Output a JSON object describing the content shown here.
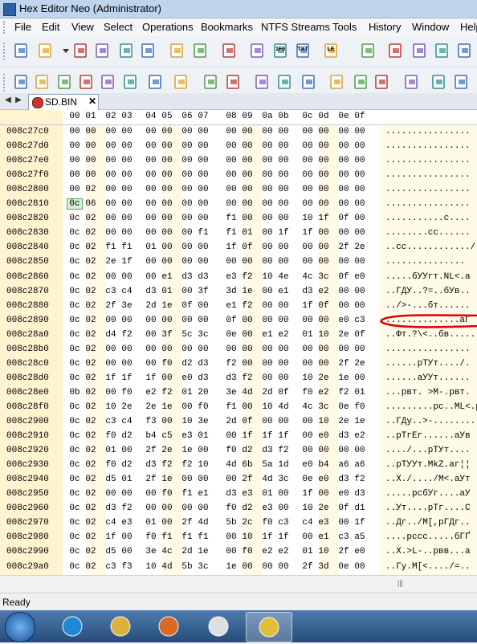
{
  "window": {
    "title": "Hex Editor Neo (Administrator)"
  },
  "menu": [
    "File",
    "Edit",
    "View",
    "Select",
    "Operations",
    "Bookmarks",
    "NTFS Streams",
    "Tools",
    "History",
    "Window",
    "Help"
  ],
  "toolbar1": [
    "new-document-icon",
    "open-folder-icon",
    "dropdown-arrow-icon",
    "save-icon",
    "save-as-icon",
    "save-all-icon",
    "print-icon",
    "close-document-icon",
    "close-all-icon",
    "refresh-icon",
    "data-inspector-icon",
    "view-hex-icon",
    "view-text-icon",
    "little-endian-icon",
    "grid-icon",
    "find-icon",
    "replace-icon",
    "find-next-icon",
    "plugin-icon"
  ],
  "toolbar1_labels": {
    "view_hex": "1F0",
    "view_text": "TXT",
    "endian": "LE"
  },
  "toolbar2": [
    "undo-icon",
    "redo-icon",
    "edit-icon",
    "insert-icon",
    "import-icon",
    "delete-icon",
    "fill-icon",
    "bookmark-icon",
    "copy-icon",
    "paste-icon",
    "download-icon",
    "settings-icon",
    "export-icon",
    "zoom-icon",
    "zoom-out-icon",
    "zoom-in-icon",
    "tools-icon",
    "green-arrow-icon",
    "patch-icon"
  ],
  "tab": {
    "label": "SD.BIN",
    "close": "✕"
  },
  "columns": [
    "00",
    "01",
    "02",
    "03",
    "04",
    "05",
    "06",
    "07",
    "08",
    "09",
    "0a",
    "0b",
    "0c",
    "0d",
    "0e",
    "0f"
  ],
  "rows": [
    {
      "offset": "008c27c0",
      "hex": [
        "00",
        "00",
        "00",
        "00",
        "00",
        "00",
        "00",
        "00",
        "00",
        "00",
        "00",
        "00",
        "00",
        "00",
        "00",
        "00"
      ],
      "ascii": "................"
    },
    {
      "offset": "008c27d0",
      "hex": [
        "00",
        "00",
        "00",
        "00",
        "00",
        "00",
        "00",
        "00",
        "00",
        "00",
        "00",
        "00",
        "00",
        "00",
        "00",
        "00"
      ],
      "ascii": "................"
    },
    {
      "offset": "008c27e0",
      "hex": [
        "00",
        "00",
        "00",
        "00",
        "00",
        "00",
        "00",
        "00",
        "00",
        "00",
        "00",
        "00",
        "00",
        "00",
        "00",
        "00"
      ],
      "ascii": "................"
    },
    {
      "offset": "008c27f0",
      "hex": [
        "00",
        "00",
        "00",
        "00",
        "00",
        "00",
        "00",
        "00",
        "00",
        "00",
        "00",
        "00",
        "00",
        "00",
        "00",
        "00"
      ],
      "ascii": "................"
    },
    {
      "offset": "008c2800",
      "hex": [
        "00",
        "02",
        "00",
        "00",
        "00",
        "00",
        "00",
        "00",
        "00",
        "00",
        "00",
        "00",
        "00",
        "00",
        "00",
        "00"
      ],
      "ascii": "................"
    },
    {
      "offset": "008c2810",
      "hex": [
        "0c",
        "06",
        "00",
        "00",
        "00",
        "00",
        "00",
        "00",
        "00",
        "00",
        "00",
        "00",
        "00",
        "00",
        "00",
        "00"
      ],
      "ascii": "................"
    },
    {
      "offset": "008c2820",
      "hex": [
        "0c",
        "02",
        "00",
        "00",
        "00",
        "00",
        "00",
        "00",
        "f1",
        "00",
        "00",
        "00",
        "10",
        "1f",
        "0f",
        "00"
      ],
      "ascii": "...........с...."
    },
    {
      "offset": "008c2830",
      "hex": [
        "0c",
        "02",
        "00",
        "00",
        "00",
        "00",
        "00",
        "f1",
        "f1",
        "01",
        "00",
        "1f",
        "1f",
        "00",
        "00",
        "00"
      ],
      "ascii": "........сс......"
    },
    {
      "offset": "008c2840",
      "hex": [
        "0c",
        "02",
        "f1",
        "f1",
        "01",
        "00",
        "00",
        "00",
        "1f",
        "0f",
        "00",
        "00",
        "00",
        "00",
        "2f",
        "2e"
      ],
      "ascii": "..сс............/."
    },
    {
      "offset": "008c2850",
      "hex": [
        "0c",
        "02",
        "2e",
        "1f",
        "00",
        "00",
        "00",
        "00",
        "00",
        "00",
        "00",
        "00",
        "00",
        "00",
        "00",
        "00"
      ],
      "ascii": "..............."
    },
    {
      "offset": "008c2860",
      "hex": [
        "0c",
        "02",
        "00",
        "00",
        "00",
        "e1",
        "d3",
        "d3",
        "e3",
        "f2",
        "10",
        "4e",
        "4c",
        "3c",
        "0f",
        "e0"
      ],
      "ascii": ".....бУУгт.NL<.а"
    },
    {
      "offset": "008c2870",
      "hex": [
        "0c",
        "02",
        "c3",
        "c4",
        "d3",
        "01",
        "00",
        "3f",
        "3d",
        "1e",
        "00",
        "e1",
        "d3",
        "e2",
        "00",
        "00"
      ],
      "ascii": "..ГДУ..?=..бУв.."
    },
    {
      "offset": "008c2880",
      "hex": [
        "0c",
        "02",
        "2f",
        "3e",
        "2d",
        "1e",
        "0f",
        "00",
        "e1",
        "f2",
        "00",
        "00",
        "1f",
        "0f",
        "00",
        "00"
      ],
      "ascii": "../>-...бт......"
    },
    {
      "offset": "008c2890",
      "hex": [
        "0c",
        "02",
        "00",
        "00",
        "00",
        "00",
        "00",
        "00",
        "0f",
        "00",
        "00",
        "00",
        "00",
        "00",
        "e0",
        "c3"
      ],
      "ascii": "..............аГ"
    },
    {
      "offset": "008c28a0",
      "hex": [
        "0c",
        "02",
        "d4",
        "f2",
        "00",
        "3f",
        "5c",
        "3c",
        "0e",
        "00",
        "e1",
        "e2",
        "01",
        "10",
        "2e",
        "0f"
      ],
      "ascii": "..Фт.?\\<..бв....."
    },
    {
      "offset": "008c28b0",
      "hex": [
        "0c",
        "02",
        "00",
        "00",
        "00",
        "00",
        "00",
        "00",
        "00",
        "00",
        "00",
        "00",
        "00",
        "00",
        "00",
        "00"
      ],
      "ascii": "................"
    },
    {
      "offset": "008c28c0",
      "hex": [
        "0c",
        "02",
        "00",
        "00",
        "00",
        "f0",
        "d2",
        "d3",
        "f2",
        "00",
        "00",
        "00",
        "00",
        "00",
        "2f",
        "2e"
      ],
      "ascii": "......рТУт..../."
    },
    {
      "offset": "008c28d0",
      "hex": [
        "0c",
        "02",
        "1f",
        "1f",
        "1f",
        "00",
        "e0",
        "d3",
        "d3",
        "f2",
        "00",
        "00",
        "10",
        "2e",
        "1e",
        "00"
      ],
      "ascii": "......аУУт......"
    },
    {
      "offset": "008c28e0",
      "hex": [
        "0b",
        "02",
        "00",
        "f0",
        "e2",
        "f2",
        "01",
        "20",
        "3e",
        "4d",
        "2d",
        "0f",
        "f0",
        "e2",
        "f2",
        "01"
      ],
      "ascii": "...рвт. >M-.рвт."
    },
    {
      "offset": "008c28f0",
      "hex": [
        "0c",
        "02",
        "10",
        "2e",
        "2e",
        "1e",
        "00",
        "f0",
        "f1",
        "00",
        "10",
        "4d",
        "4c",
        "3c",
        "0e",
        "f0"
      ],
      "ascii": ".........рс..ML<.р"
    },
    {
      "offset": "008c2900",
      "hex": [
        "0c",
        "02",
        "c3",
        "c4",
        "f3",
        "00",
        "10",
        "3e",
        "2d",
        "0f",
        "00",
        "00",
        "00",
        "10",
        "2e",
        "1e"
      ],
      "ascii": "..ГДу..>-........"
    },
    {
      "offset": "008c2910",
      "hex": [
        "0c",
        "02",
        "f0",
        "d2",
        "b4",
        "c5",
        "e3",
        "01",
        "00",
        "1f",
        "1f",
        "1f",
        "00",
        "e0",
        "d3",
        "e2"
      ],
      "ascii": "..рТгЕг......аУв"
    },
    {
      "offset": "008c2920",
      "hex": [
        "0c",
        "02",
        "01",
        "00",
        "2f",
        "2e",
        "1e",
        "00",
        "f0",
        "d2",
        "d3",
        "f2",
        "00",
        "00",
        "00",
        "00"
      ],
      "ascii": "..../...рТУт...."
    },
    {
      "offset": "008c2930",
      "hex": [
        "0c",
        "02",
        "f0",
        "d2",
        "d3",
        "f2",
        "f2",
        "10",
        "4d",
        "6b",
        "5a",
        "1d",
        "e0",
        "b4",
        "a6",
        "a6"
      ],
      "ascii": "..рТУУт.MkZ.аг¦¦"
    },
    {
      "offset": "008c2940",
      "hex": [
        "0c",
        "02",
        "d5",
        "01",
        "2f",
        "1e",
        "00",
        "00",
        "00",
        "2f",
        "4d",
        "3c",
        "0e",
        "e0",
        "d3",
        "f2"
      ],
      "ascii": "..Х./..../M<.аУт"
    },
    {
      "offset": "008c2950",
      "hex": [
        "0c",
        "02",
        "00",
        "00",
        "00",
        "f0",
        "f1",
        "e1",
        "d3",
        "e3",
        "01",
        "00",
        "1f",
        "00",
        "e0",
        "d3"
      ],
      "ascii": ".....рсбУг....аУ"
    },
    {
      "offset": "008c2960",
      "hex": [
        "0c",
        "02",
        "d3",
        "f2",
        "00",
        "00",
        "00",
        "00",
        "f0",
        "d2",
        "e3",
        "00",
        "10",
        "2e",
        "0f",
        "d1"
      ],
      "ascii": "..Ут....рТг....С"
    },
    {
      "offset": "008c2970",
      "hex": [
        "0c",
        "02",
        "c4",
        "e3",
        "01",
        "00",
        "2f",
        "4d",
        "5b",
        "2c",
        "f0",
        "c3",
        "c4",
        "e3",
        "00",
        "1f"
      ],
      "ascii": "..Дг../M[,рГДг.."
    },
    {
      "offset": "008c2980",
      "hex": [
        "0c",
        "02",
        "1f",
        "00",
        "f0",
        "f1",
        "f1",
        "f1",
        "00",
        "10",
        "1f",
        "1f",
        "00",
        "e1",
        "c3",
        "a5"
      ],
      "ascii": "....рссс.....бГҐ"
    },
    {
      "offset": "008c2990",
      "hex": [
        "0c",
        "02",
        "d5",
        "00",
        "3e",
        "4c",
        "2d",
        "1e",
        "00",
        "f0",
        "e2",
        "e2",
        "01",
        "10",
        "2f",
        "e0"
      ],
      "ascii": "..Х.>L-..рвв...а"
    },
    {
      "offset": "008c29a0",
      "hex": [
        "0c",
        "02",
        "c3",
        "f3",
        "10",
        "4d",
        "5b",
        "3c",
        "1e",
        "00",
        "00",
        "00",
        "2f",
        "3d",
        "0e",
        "00"
      ],
      "ascii": "..Гу.M[<..../=.."
    }
  ],
  "selection": {
    "row": 5,
    "col": 0
  },
  "hscroll_grip": "|||",
  "status": {
    "text": "Ready"
  },
  "taskbar": [
    "start-orb-icon",
    "internet-explorer-icon",
    "file-explorer-icon",
    "firefox-icon",
    "notepad-icon",
    "hex-editor-neo-icon"
  ],
  "colors": {
    "offset_bg": "#fff3d0",
    "selection": "#d5f0d5",
    "annotation": "#e00000"
  }
}
